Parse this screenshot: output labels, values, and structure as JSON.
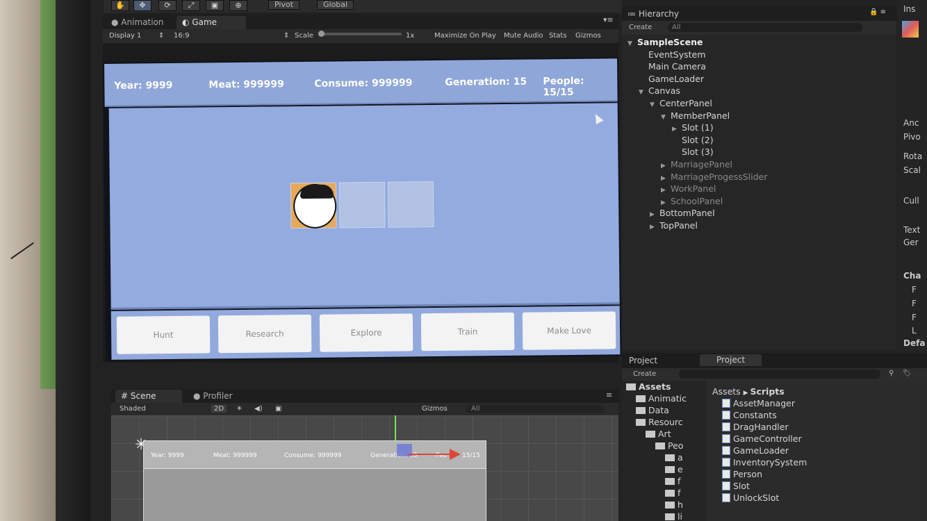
{
  "toolbar": {
    "tools": [
      "hand-icon",
      "move-icon",
      "rotate-icon",
      "scale-icon",
      "rect-icon",
      "transform-icon"
    ],
    "pivot": "Pivot",
    "global": "Global"
  },
  "game_tabs": {
    "animation": "Animation",
    "game": "Game"
  },
  "game_bar": {
    "display": "Display 1",
    "aspect": "16:9",
    "scale_label": "Scale",
    "scale_value": "1x",
    "maximize": "Maximize On Play",
    "mute": "Mute Audio",
    "stats": "Stats",
    "gizmos": "Gizmos"
  },
  "game": {
    "year": "Year: 9999",
    "meat": "Meat: 999999",
    "consume": "Consume: 999999",
    "generation": "Generation: 15",
    "people": "People: 15/15",
    "buttons": [
      "Hunt",
      "Research",
      "Explore",
      "Train",
      "Make Love"
    ],
    "slots_filled": 1,
    "slots_total": 3
  },
  "scene_tabs": {
    "scene": "Scene",
    "profiler": "Profiler"
  },
  "scene_bar": {
    "shading": "Shaded",
    "mode_2d": "2D",
    "gizmos": "Gizmos",
    "search": "All"
  },
  "scene": {
    "year": "Year: 9999",
    "meat": "Meat: 999999",
    "consume": "Consume: 999999",
    "generation": "Generation: 15",
    "people": "Peo",
    "people_tail": "15/15"
  },
  "hierarchy": {
    "title": "Hierarchy",
    "create": "Create",
    "search": "All",
    "rows": [
      {
        "label": "SampleScene",
        "depth": 0,
        "arrow": "▼",
        "bold": true
      },
      {
        "label": "EventSystem",
        "depth": 1,
        "arrow": ""
      },
      {
        "label": "Main Camera",
        "depth": 1,
        "arrow": ""
      },
      {
        "label": "GameLoader",
        "depth": 1,
        "arrow": ""
      },
      {
        "label": "Canvas",
        "depth": 1,
        "arrow": "▼"
      },
      {
        "label": "CenterPanel",
        "depth": 2,
        "arrow": "▼"
      },
      {
        "label": "MemberPanel",
        "depth": 3,
        "arrow": "▼"
      },
      {
        "label": "Slot (1)",
        "depth": 4,
        "arrow": "▶"
      },
      {
        "label": "Slot (2)",
        "depth": 4,
        "arrow": ""
      },
      {
        "label": "Slot (3)",
        "depth": 4,
        "arrow": ""
      },
      {
        "label": "MarriagePanel",
        "depth": 3,
        "arrow": "▶",
        "dim": true
      },
      {
        "label": "MarriageProgessSlider",
        "depth": 3,
        "arrow": "▶",
        "dim": true
      },
      {
        "label": "WorkPanel",
        "depth": 3,
        "arrow": "▶",
        "dim": true
      },
      {
        "label": "SchoolPanel",
        "depth": 3,
        "arrow": "▶",
        "dim": true
      },
      {
        "label": "BottomPanel",
        "depth": 2,
        "arrow": "▶"
      },
      {
        "label": "TopPanel",
        "depth": 2,
        "arrow": "▶"
      }
    ]
  },
  "project": {
    "tab1": "Project",
    "tab2": "Project",
    "create": "Create",
    "folders": [
      {
        "label": "Assets",
        "depth": 0,
        "bold": true
      },
      {
        "label": "Animatic",
        "depth": 1
      },
      {
        "label": "Data",
        "depth": 1
      },
      {
        "label": "Resourc",
        "depth": 1
      },
      {
        "label": "Art",
        "depth": 2
      },
      {
        "label": "Peo",
        "depth": 3
      },
      {
        "label": "a",
        "depth": 4
      },
      {
        "label": "e",
        "depth": 4
      },
      {
        "label": "f",
        "depth": 4
      },
      {
        "label": "f",
        "depth": 4
      },
      {
        "label": "h",
        "depth": 4
      },
      {
        "label": "li",
        "depth": 4
      }
    ],
    "breadcrumb_root": "Assets",
    "breadcrumb_leaf": "Scripts",
    "files": [
      "AssetManager",
      "Constants",
      "DragHandler",
      "GameController",
      "GameLoader",
      "InventorySystem",
      "Person",
      "Slot",
      "UnlockSlot"
    ]
  },
  "inspector": {
    "title": "Ins",
    "rows": [
      "Anc",
      "Pivo",
      "Rota",
      "Scal",
      "Cull",
      "Text",
      "Ger",
      "Cha",
      "F",
      "F",
      "F",
      "L",
      "Defa"
    ]
  }
}
